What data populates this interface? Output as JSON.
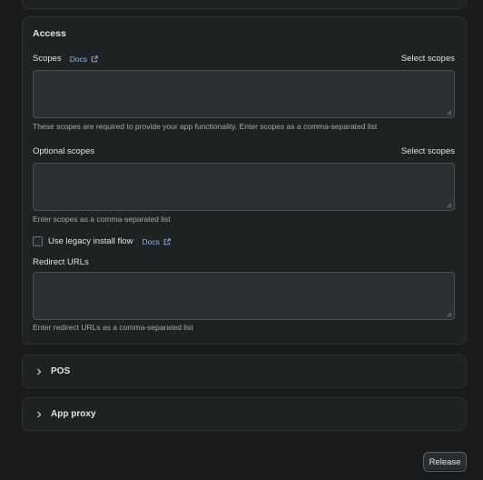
{
  "access": {
    "title": "Access",
    "scopes": {
      "label": "Scopes",
      "docs_label": "Docs",
      "select_label": "Select scopes",
      "value": "",
      "help": "These scopes are required to provide your app functionality. Enter scopes as a comma-separated list"
    },
    "optional_scopes": {
      "label": "Optional scopes",
      "select_label": "Select scopes",
      "value": "",
      "help": "Enter scopes as a comma-separated list"
    },
    "legacy_install": {
      "label": "Use legacy install flow",
      "docs_label": "Docs",
      "checked": false
    },
    "redirect_urls": {
      "label": "Redirect URLs",
      "value": "",
      "help": "Enter redirect URLs as a comma-separated list"
    }
  },
  "pos": {
    "title": "POS"
  },
  "app_proxy": {
    "title": "App proxy"
  },
  "footer": {
    "release_label": "Release"
  },
  "icons": {
    "external_link": "external-link-icon",
    "chevron": "chevron-right-icon",
    "resize": "resize-grip-icon"
  },
  "colors": {
    "background": "#1a1b1c",
    "card": "#1f2223",
    "link": "#8fb5f0",
    "input_bg": "#2b2f31"
  }
}
